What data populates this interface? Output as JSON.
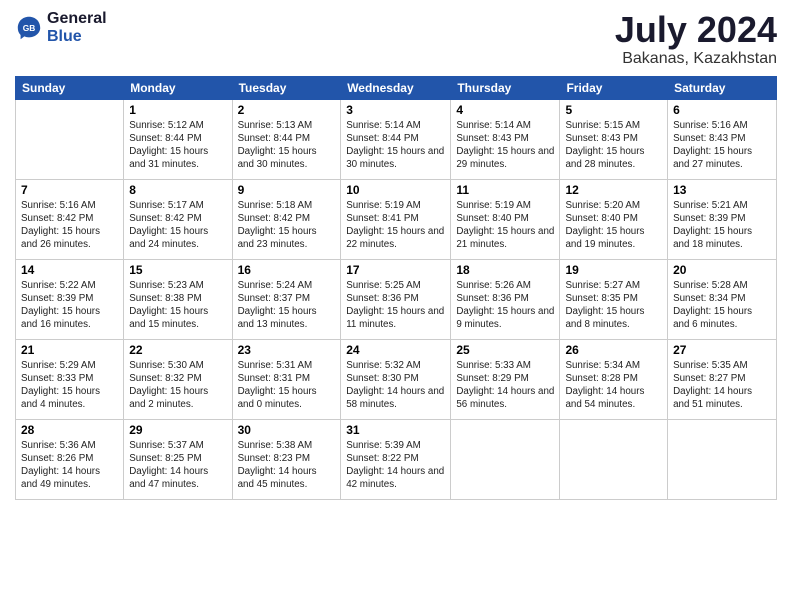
{
  "logo": {
    "general": "General",
    "blue": "Blue"
  },
  "header": {
    "month_year": "July 2024",
    "location": "Bakanas, Kazakhstan"
  },
  "weekdays": [
    "Sunday",
    "Monday",
    "Tuesday",
    "Wednesday",
    "Thursday",
    "Friday",
    "Saturday"
  ],
  "weeks": [
    [
      {
        "day": "",
        "sunrise": "",
        "sunset": "",
        "daylight": ""
      },
      {
        "day": "1",
        "sunrise": "Sunrise: 5:12 AM",
        "sunset": "Sunset: 8:44 PM",
        "daylight": "Daylight: 15 hours and 31 minutes."
      },
      {
        "day": "2",
        "sunrise": "Sunrise: 5:13 AM",
        "sunset": "Sunset: 8:44 PM",
        "daylight": "Daylight: 15 hours and 30 minutes."
      },
      {
        "day": "3",
        "sunrise": "Sunrise: 5:14 AM",
        "sunset": "Sunset: 8:44 PM",
        "daylight": "Daylight: 15 hours and 30 minutes."
      },
      {
        "day": "4",
        "sunrise": "Sunrise: 5:14 AM",
        "sunset": "Sunset: 8:43 PM",
        "daylight": "Daylight: 15 hours and 29 minutes."
      },
      {
        "day": "5",
        "sunrise": "Sunrise: 5:15 AM",
        "sunset": "Sunset: 8:43 PM",
        "daylight": "Daylight: 15 hours and 28 minutes."
      },
      {
        "day": "6",
        "sunrise": "Sunrise: 5:16 AM",
        "sunset": "Sunset: 8:43 PM",
        "daylight": "Daylight: 15 hours and 27 minutes."
      }
    ],
    [
      {
        "day": "7",
        "sunrise": "Sunrise: 5:16 AM",
        "sunset": "Sunset: 8:42 PM",
        "daylight": "Daylight: 15 hours and 26 minutes."
      },
      {
        "day": "8",
        "sunrise": "Sunrise: 5:17 AM",
        "sunset": "Sunset: 8:42 PM",
        "daylight": "Daylight: 15 hours and 24 minutes."
      },
      {
        "day": "9",
        "sunrise": "Sunrise: 5:18 AM",
        "sunset": "Sunset: 8:42 PM",
        "daylight": "Daylight: 15 hours and 23 minutes."
      },
      {
        "day": "10",
        "sunrise": "Sunrise: 5:19 AM",
        "sunset": "Sunset: 8:41 PM",
        "daylight": "Daylight: 15 hours and 22 minutes."
      },
      {
        "day": "11",
        "sunrise": "Sunrise: 5:19 AM",
        "sunset": "Sunset: 8:40 PM",
        "daylight": "Daylight: 15 hours and 21 minutes."
      },
      {
        "day": "12",
        "sunrise": "Sunrise: 5:20 AM",
        "sunset": "Sunset: 8:40 PM",
        "daylight": "Daylight: 15 hours and 19 minutes."
      },
      {
        "day": "13",
        "sunrise": "Sunrise: 5:21 AM",
        "sunset": "Sunset: 8:39 PM",
        "daylight": "Daylight: 15 hours and 18 minutes."
      }
    ],
    [
      {
        "day": "14",
        "sunrise": "Sunrise: 5:22 AM",
        "sunset": "Sunset: 8:39 PM",
        "daylight": "Daylight: 15 hours and 16 minutes."
      },
      {
        "day": "15",
        "sunrise": "Sunrise: 5:23 AM",
        "sunset": "Sunset: 8:38 PM",
        "daylight": "Daylight: 15 hours and 15 minutes."
      },
      {
        "day": "16",
        "sunrise": "Sunrise: 5:24 AM",
        "sunset": "Sunset: 8:37 PM",
        "daylight": "Daylight: 15 hours and 13 minutes."
      },
      {
        "day": "17",
        "sunrise": "Sunrise: 5:25 AM",
        "sunset": "Sunset: 8:36 PM",
        "daylight": "Daylight: 15 hours and 11 minutes."
      },
      {
        "day": "18",
        "sunrise": "Sunrise: 5:26 AM",
        "sunset": "Sunset: 8:36 PM",
        "daylight": "Daylight: 15 hours and 9 minutes."
      },
      {
        "day": "19",
        "sunrise": "Sunrise: 5:27 AM",
        "sunset": "Sunset: 8:35 PM",
        "daylight": "Daylight: 15 hours and 8 minutes."
      },
      {
        "day": "20",
        "sunrise": "Sunrise: 5:28 AM",
        "sunset": "Sunset: 8:34 PM",
        "daylight": "Daylight: 15 hours and 6 minutes."
      }
    ],
    [
      {
        "day": "21",
        "sunrise": "Sunrise: 5:29 AM",
        "sunset": "Sunset: 8:33 PM",
        "daylight": "Daylight: 15 hours and 4 minutes."
      },
      {
        "day": "22",
        "sunrise": "Sunrise: 5:30 AM",
        "sunset": "Sunset: 8:32 PM",
        "daylight": "Daylight: 15 hours and 2 minutes."
      },
      {
        "day": "23",
        "sunrise": "Sunrise: 5:31 AM",
        "sunset": "Sunset: 8:31 PM",
        "daylight": "Daylight: 15 hours and 0 minutes."
      },
      {
        "day": "24",
        "sunrise": "Sunrise: 5:32 AM",
        "sunset": "Sunset: 8:30 PM",
        "daylight": "Daylight: 14 hours and 58 minutes."
      },
      {
        "day": "25",
        "sunrise": "Sunrise: 5:33 AM",
        "sunset": "Sunset: 8:29 PM",
        "daylight": "Daylight: 14 hours and 56 minutes."
      },
      {
        "day": "26",
        "sunrise": "Sunrise: 5:34 AM",
        "sunset": "Sunset: 8:28 PM",
        "daylight": "Daylight: 14 hours and 54 minutes."
      },
      {
        "day": "27",
        "sunrise": "Sunrise: 5:35 AM",
        "sunset": "Sunset: 8:27 PM",
        "daylight": "Daylight: 14 hours and 51 minutes."
      }
    ],
    [
      {
        "day": "28",
        "sunrise": "Sunrise: 5:36 AM",
        "sunset": "Sunset: 8:26 PM",
        "daylight": "Daylight: 14 hours and 49 minutes."
      },
      {
        "day": "29",
        "sunrise": "Sunrise: 5:37 AM",
        "sunset": "Sunset: 8:25 PM",
        "daylight": "Daylight: 14 hours and 47 minutes."
      },
      {
        "day": "30",
        "sunrise": "Sunrise: 5:38 AM",
        "sunset": "Sunset: 8:23 PM",
        "daylight": "Daylight: 14 hours and 45 minutes."
      },
      {
        "day": "31",
        "sunrise": "Sunrise: 5:39 AM",
        "sunset": "Sunset: 8:22 PM",
        "daylight": "Daylight: 14 hours and 42 minutes."
      },
      {
        "day": "",
        "sunrise": "",
        "sunset": "",
        "daylight": ""
      },
      {
        "day": "",
        "sunrise": "",
        "sunset": "",
        "daylight": ""
      },
      {
        "day": "",
        "sunrise": "",
        "sunset": "",
        "daylight": ""
      }
    ]
  ]
}
